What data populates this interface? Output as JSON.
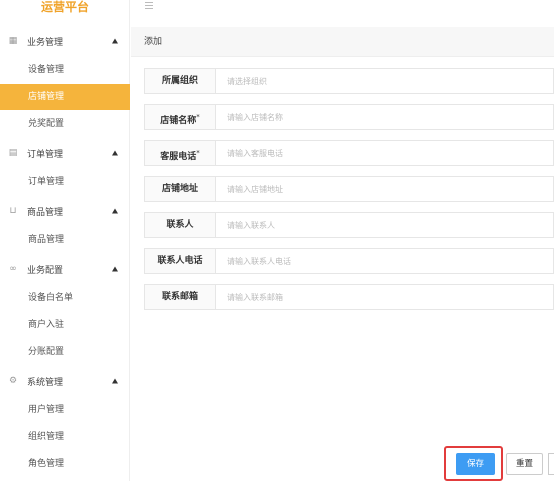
{
  "brand": "运营平台",
  "sidebar": {
    "groups": [
      {
        "label": "业务管理",
        "icon": "grid-plus-icon",
        "items": [
          "设备管理",
          "店铺管理",
          "兑奖配置"
        ]
      },
      {
        "label": "订单管理",
        "icon": "calendar-icon",
        "items": [
          "订单管理"
        ]
      },
      {
        "label": "商品管理",
        "icon": "cart-icon",
        "items": [
          "商品管理"
        ]
      },
      {
        "label": "业务配置",
        "icon": "binoculars-icon",
        "items": [
          "设备白名单",
          "商户入驻",
          "分账配置"
        ]
      },
      {
        "label": "系统管理",
        "icon": "gear-icon",
        "items": [
          "用户管理",
          "组织管理",
          "角色管理"
        ]
      }
    ],
    "active_item": "店铺管理"
  },
  "tab": {
    "title": "添加"
  },
  "form": {
    "fields": [
      {
        "label": "所属组织",
        "required": false,
        "placeholder": "请选择组织",
        "value": ""
      },
      {
        "label": "店铺名称",
        "required": true,
        "placeholder": "请输入店铺名称",
        "value": ""
      },
      {
        "label": "客服电话",
        "required": true,
        "placeholder": "请输入客服电话",
        "value": ""
      },
      {
        "label": "店铺地址",
        "required": false,
        "placeholder": "请输入店铺地址",
        "value": ""
      },
      {
        "label": "联系人",
        "required": false,
        "placeholder": "请输入联系人",
        "value": ""
      },
      {
        "label": "联系人电话",
        "required": false,
        "placeholder": "请输入联系人电话",
        "value": ""
      },
      {
        "label": "联系邮箱",
        "required": false,
        "placeholder": "请输入联系邮箱",
        "value": ""
      }
    ],
    "required_mark": "*"
  },
  "actions": {
    "save_label": "保存",
    "reset_label": "重置"
  },
  "colors": {
    "brand": "#f0a32a",
    "active_bg": "#f5b43c",
    "primary": "#3d9cf3",
    "highlight": "#e23c3c"
  }
}
